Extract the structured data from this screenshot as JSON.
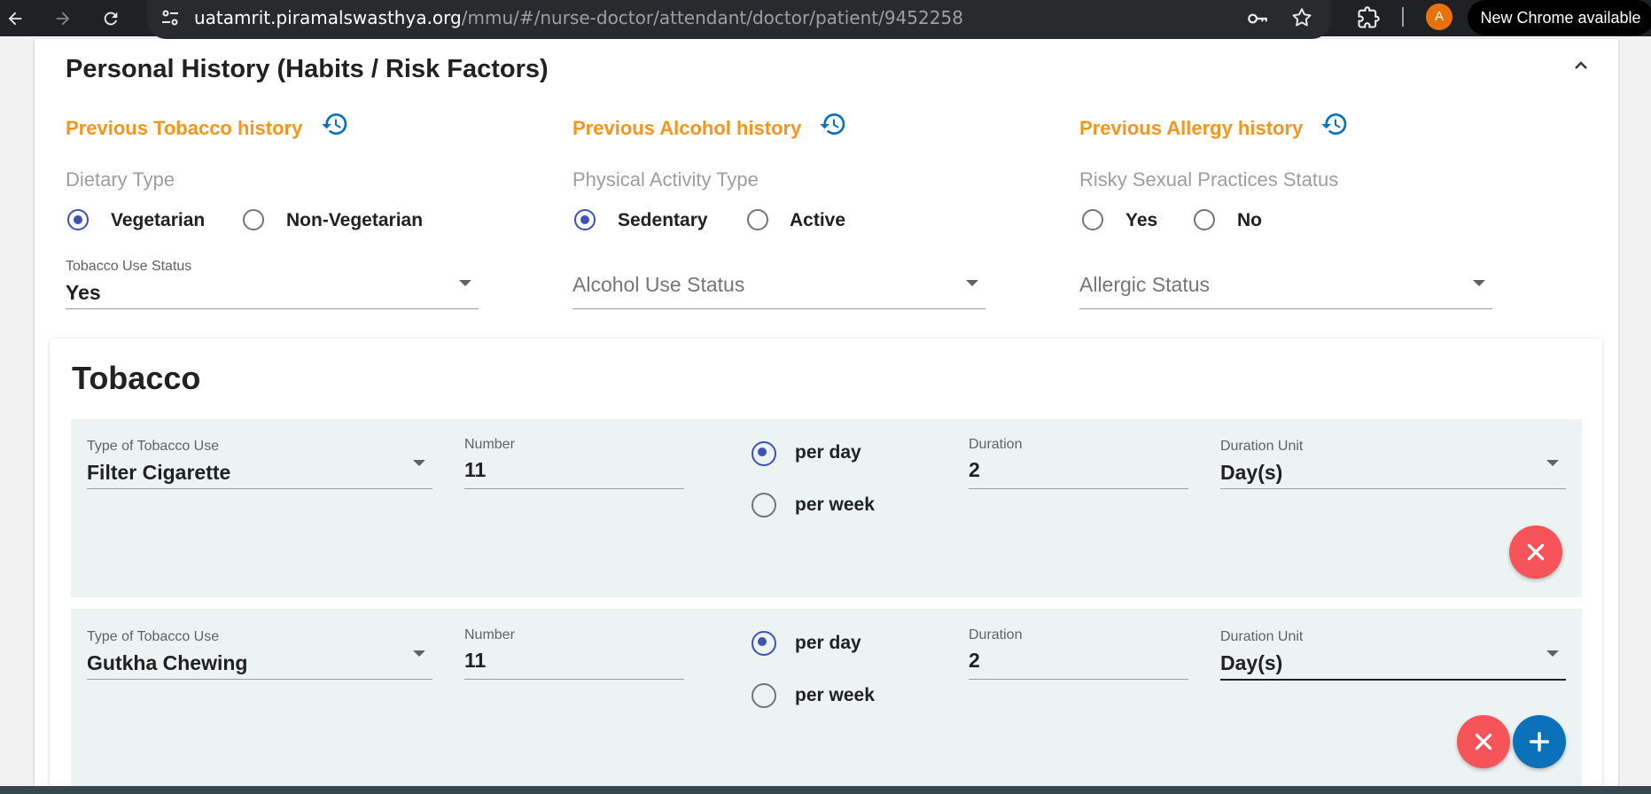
{
  "browser": {
    "url_host": "uatamrit.piramalswasthya.org",
    "url_path": "/mmu/#/nurse-doctor/attendant/doctor/patient/9452258",
    "new_chrome_label": "New Chrome available",
    "avatar_letter": "A"
  },
  "personal_history": {
    "title": "Personal History (Habits / Risk Factors)",
    "links": {
      "tobacco": "Previous Tobacco history",
      "alcohol": "Previous Alcohol history",
      "allergy": "Previous Allergy history"
    },
    "dietary": {
      "label": "Dietary Type",
      "options": [
        "Vegetarian",
        "Non-Vegetarian"
      ],
      "selected": "Vegetarian"
    },
    "physical_activity": {
      "label": "Physical Activity Type",
      "options": [
        "Sedentary",
        "Active"
      ],
      "selected": "Sedentary"
    },
    "risky_sexual": {
      "label": "Risky Sexual Practices Status",
      "options": [
        "Yes",
        "No"
      ],
      "selected": ""
    },
    "tobacco_use": {
      "label": "Tobacco Use Status",
      "value": "Yes"
    },
    "alcohol_use": {
      "placeholder": "Alcohol Use Status"
    },
    "allergic": {
      "placeholder": "Allergic Status"
    }
  },
  "tobacco": {
    "title": "Tobacco",
    "labels": {
      "type": "Type of Tobacco Use",
      "number": "Number",
      "per_day": "per day",
      "per_week": "per week",
      "duration": "Duration",
      "duration_unit": "Duration Unit"
    },
    "rows": [
      {
        "type": "Filter Cigarette",
        "number": "11",
        "frequency": "per day",
        "duration": "2",
        "duration_unit": "Day(s)"
      },
      {
        "type": "Gutkha Chewing",
        "number": "11",
        "frequency": "per day",
        "duration": "2",
        "duration_unit": "Day(s)"
      }
    ]
  },
  "colors": {
    "accent_orange": "#f7941d",
    "radio_blue": "#3f51b5",
    "remove_red": "#f7545a",
    "add_blue": "#0b72b9"
  },
  "icons": [
    "arrow-left-icon",
    "arrow-right-icon",
    "reload-icon",
    "tune-icon",
    "key-icon",
    "star-icon",
    "extensions-icon",
    "history-icon",
    "chevron-up-icon",
    "close-icon",
    "plus-icon"
  ]
}
